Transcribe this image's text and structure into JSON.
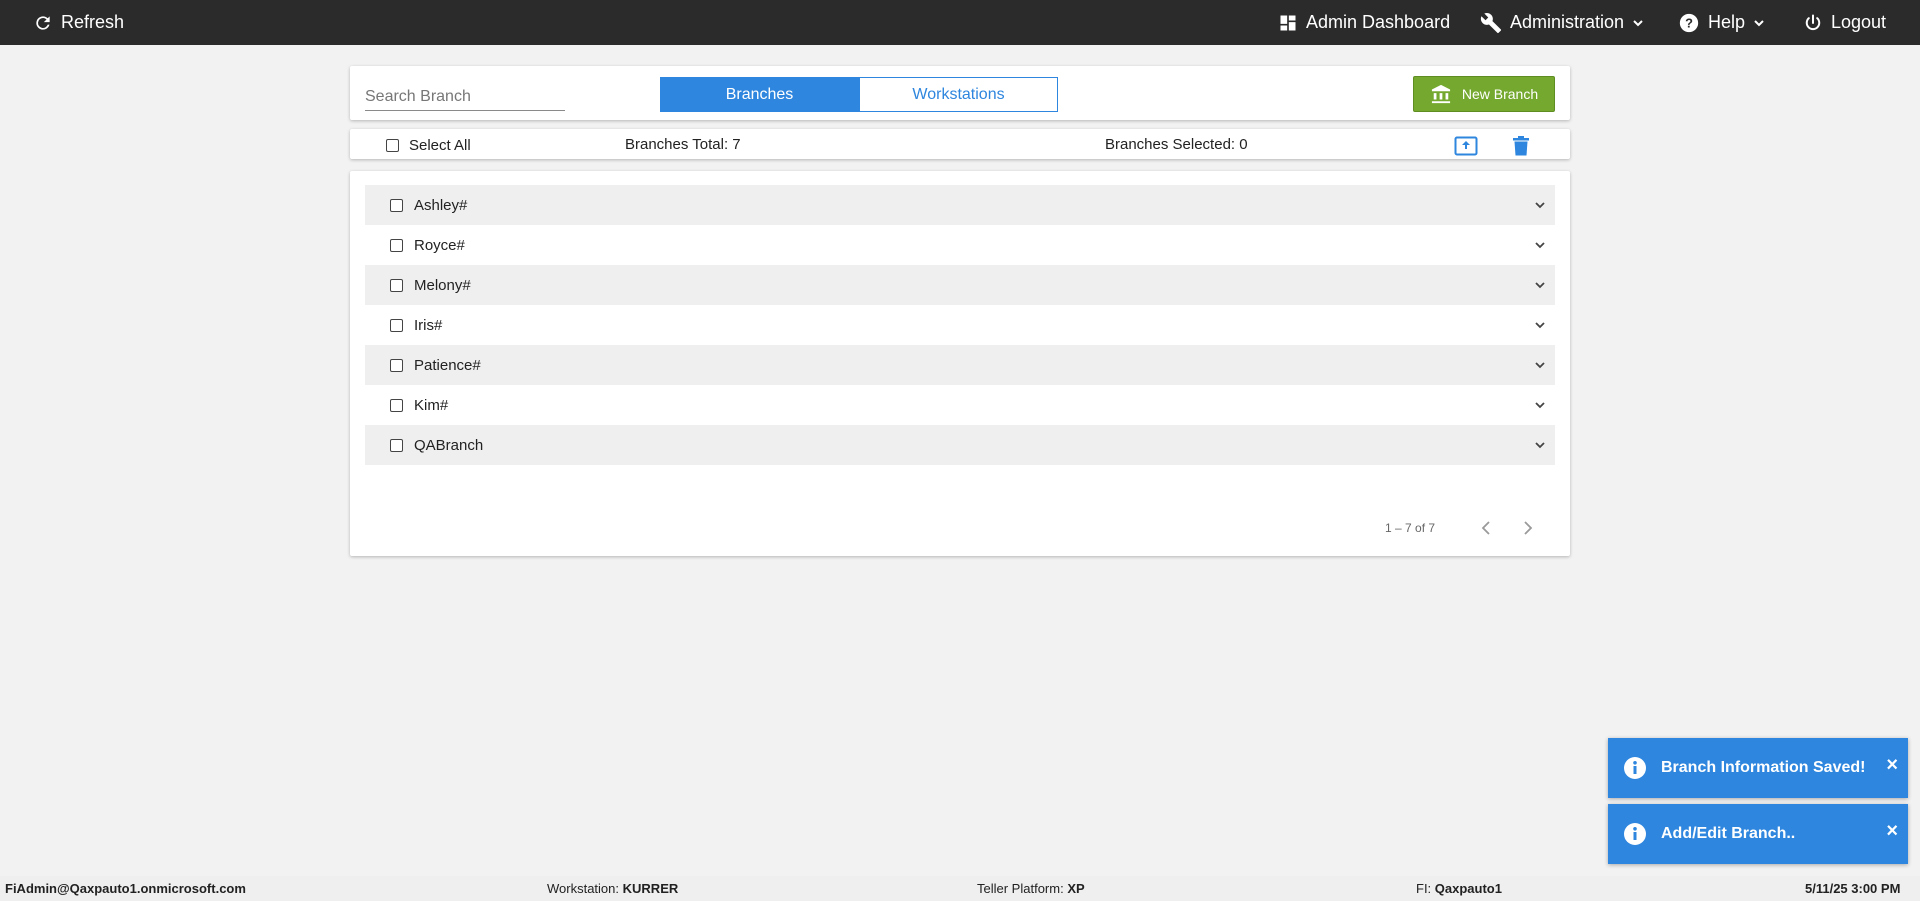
{
  "topbar": {
    "refresh": "Refresh",
    "admin_dashboard": "Admin Dashboard",
    "administration": "Administration",
    "help": "Help",
    "logout": "Logout"
  },
  "toolbar": {
    "search_placeholder": "Search Branch",
    "tabs": [
      "Branches",
      "Workstations"
    ],
    "active_tab": "Branches",
    "new_branch": "New Branch"
  },
  "selection": {
    "select_all": "Select All",
    "total": "Branches Total: 7",
    "selected": "Branches Selected: 0"
  },
  "branches": [
    "Ashley#",
    "Royce#",
    "Melony#",
    "Iris#",
    "Patience#",
    "Kim#",
    "QABranch"
  ],
  "pager": {
    "range": "1 – 7 of 7"
  },
  "toasts": [
    "Branch Information Saved!",
    "Add/Edit Branch.."
  ],
  "footer": {
    "user": "FiAdmin@Qaxpauto1.onmicrosoft.com",
    "workstation_label": "Workstation:",
    "workstation": "KURRER",
    "platform_label": "Teller Platform:",
    "platform": "XP",
    "fi_label": "FI:",
    "fi": "Qaxpauto1",
    "datetime": "5/11/25 3:00 PM"
  },
  "colors": {
    "primary": "#2e86de",
    "success": "#74a82e",
    "topbar": "#2b2b2b"
  },
  "icons": {
    "refresh": "refresh-icon",
    "dashboard": "dashboard-icon",
    "admin": "wrench-icon",
    "help": "help-icon",
    "logout": "power-icon",
    "new_branch": "bank-icon",
    "upload": "upload-icon",
    "delete": "trash-icon",
    "row": "chevron-down-icon",
    "pager_prev": "chevron-left-icon",
    "pager_next": "chevron-right-icon",
    "toast": "info-icon",
    "toast_close": "close-icon"
  }
}
